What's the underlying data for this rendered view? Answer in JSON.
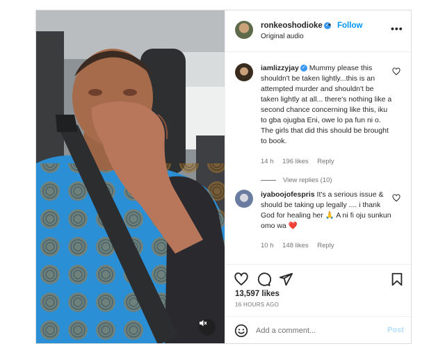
{
  "post": {
    "author": {
      "username": "ronkeoshodioke",
      "verified": true,
      "follow_label": "Follow",
      "separator": "•",
      "subtitle": "Original audio"
    },
    "more_label": "•••",
    "comments": [
      {
        "username": "iamlizzyjay",
        "verified": true,
        "text": "Mummy please this shouldn't be taken lightly...this is an attempted murder and shouldn't be taken lightly at all... there's nothing like a second chance concerning like this, iku to gba ojugba Eni, owe lo pa fun ni o. The girls that did this should be brought to book.",
        "time": "14 h",
        "likes": "196 likes",
        "reply_label": "Reply",
        "view_replies": "View replies (10)"
      },
      {
        "username": "iyaboojofespris",
        "verified": false,
        "text": "It's a serious issue & should be taking up legally .... i thank God for healing her 🙏 A ni fi oju sunkun omo wa ❤️",
        "time": "10 h",
        "likes": "148 likes",
        "reply_label": "Reply"
      }
    ],
    "likes_count": "13,597 likes",
    "time_ago": "16 HOURS AGO",
    "add_comment_placeholder": "Add a comment...",
    "post_label": "Post"
  },
  "icons": {
    "mute": "speaker-muted-icon",
    "like": "heart-icon",
    "comment": "comment-bubble-icon",
    "share": "paper-plane-icon",
    "save": "bookmark-icon",
    "emoji": "smiley-icon"
  },
  "colors": {
    "accent": "#0095f6",
    "post_disabled": "#b2dffc",
    "secondary_text": "#737373",
    "border": "#dbdbdb",
    "heart": "#e0245e"
  }
}
